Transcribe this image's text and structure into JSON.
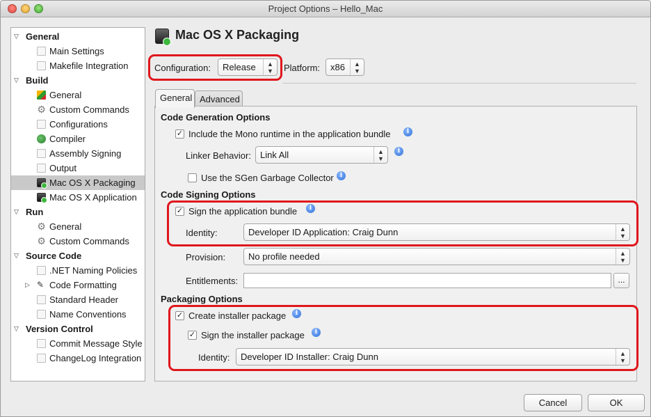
{
  "window": {
    "title": "Project Options – Hello_Mac"
  },
  "sidebar": {
    "items": [
      {
        "label": "General",
        "kind": "category",
        "icon": "none"
      },
      {
        "label": "Main Settings",
        "kind": "item",
        "icon": "blank-page-icon"
      },
      {
        "label": "Makefile Integration",
        "kind": "item",
        "icon": "blank-page-icon"
      },
      {
        "label": "Build",
        "kind": "category",
        "icon": "none"
      },
      {
        "label": "General",
        "kind": "item",
        "icon": "build-general-icon"
      },
      {
        "label": "Custom Commands",
        "kind": "item",
        "icon": "gear-icon"
      },
      {
        "label": "Configurations",
        "kind": "item",
        "icon": "blank-page-icon"
      },
      {
        "label": "Compiler",
        "kind": "item",
        "icon": "compiler-icon"
      },
      {
        "label": "Assembly Signing",
        "kind": "item",
        "icon": "blank-page-icon"
      },
      {
        "label": "Output",
        "kind": "item",
        "icon": "blank-page-icon"
      },
      {
        "label": "Mac OS X Packaging",
        "kind": "item",
        "icon": "mac-app-icon",
        "selected": true
      },
      {
        "label": "Mac OS X Application",
        "kind": "item",
        "icon": "mac-app-icon"
      },
      {
        "label": "Run",
        "kind": "category",
        "icon": "none"
      },
      {
        "label": "General",
        "kind": "item",
        "icon": "gear-icon"
      },
      {
        "label": "Custom Commands",
        "kind": "item",
        "icon": "gear-icon"
      },
      {
        "label": "Source Code",
        "kind": "category",
        "icon": "none"
      },
      {
        "label": ".NET Naming Policies",
        "kind": "item",
        "icon": "blank-page-icon"
      },
      {
        "label": "Code Formatting",
        "kind": "item",
        "icon": "code-formatting-icon",
        "collapsed": true
      },
      {
        "label": "Standard Header",
        "kind": "item",
        "icon": "blank-page-icon"
      },
      {
        "label": "Name Conventions",
        "kind": "item",
        "icon": "blank-page-icon"
      },
      {
        "label": "Version Control",
        "kind": "category",
        "icon": "none"
      },
      {
        "label": "Commit Message Style",
        "kind": "item",
        "icon": "blank-page-icon"
      },
      {
        "label": "ChangeLog Integration",
        "kind": "item",
        "icon": "blank-page-icon"
      }
    ]
  },
  "header": {
    "title": "Mac OS X Packaging"
  },
  "config": {
    "configuration_label": "Configuration:",
    "configuration_value": "Release",
    "platform_label": "Platform:",
    "platform_value": "x86"
  },
  "tabs": [
    {
      "label": "General",
      "active": true
    },
    {
      "label": "Advanced",
      "active": false
    }
  ],
  "code_generation": {
    "title": "Code Generation Options",
    "include_mono_label": "Include the Mono runtime in the application bundle",
    "include_mono_checked": true,
    "linker_label": "Linker Behavior:",
    "linker_value": "Link All",
    "sgen_label": "Use the SGen Garbage Collector",
    "sgen_checked": false
  },
  "code_signing": {
    "title": "Code Signing Options",
    "sign_bundle_label": "Sign the application bundle",
    "sign_bundle_checked": true,
    "identity_label": "Identity:",
    "identity_value": "Developer ID Application: Craig Dunn",
    "provision_label": "Provision:",
    "provision_value": "No profile needed",
    "entitlements_label": "Entitlements:",
    "entitlements_value": "",
    "browse_label": "..."
  },
  "packaging": {
    "title": "Packaging Options",
    "create_installer_label": "Create installer package",
    "create_installer_checked": true,
    "sign_installer_label": "Sign the installer package",
    "sign_installer_checked": true,
    "identity_label": "Identity:",
    "identity_value": "Developer ID Installer: Craig Dunn"
  },
  "footer": {
    "cancel_label": "Cancel",
    "ok_label": "OK"
  },
  "colors": {
    "highlight_border": "#e0161c",
    "selected_row": "#c9c9c9"
  }
}
